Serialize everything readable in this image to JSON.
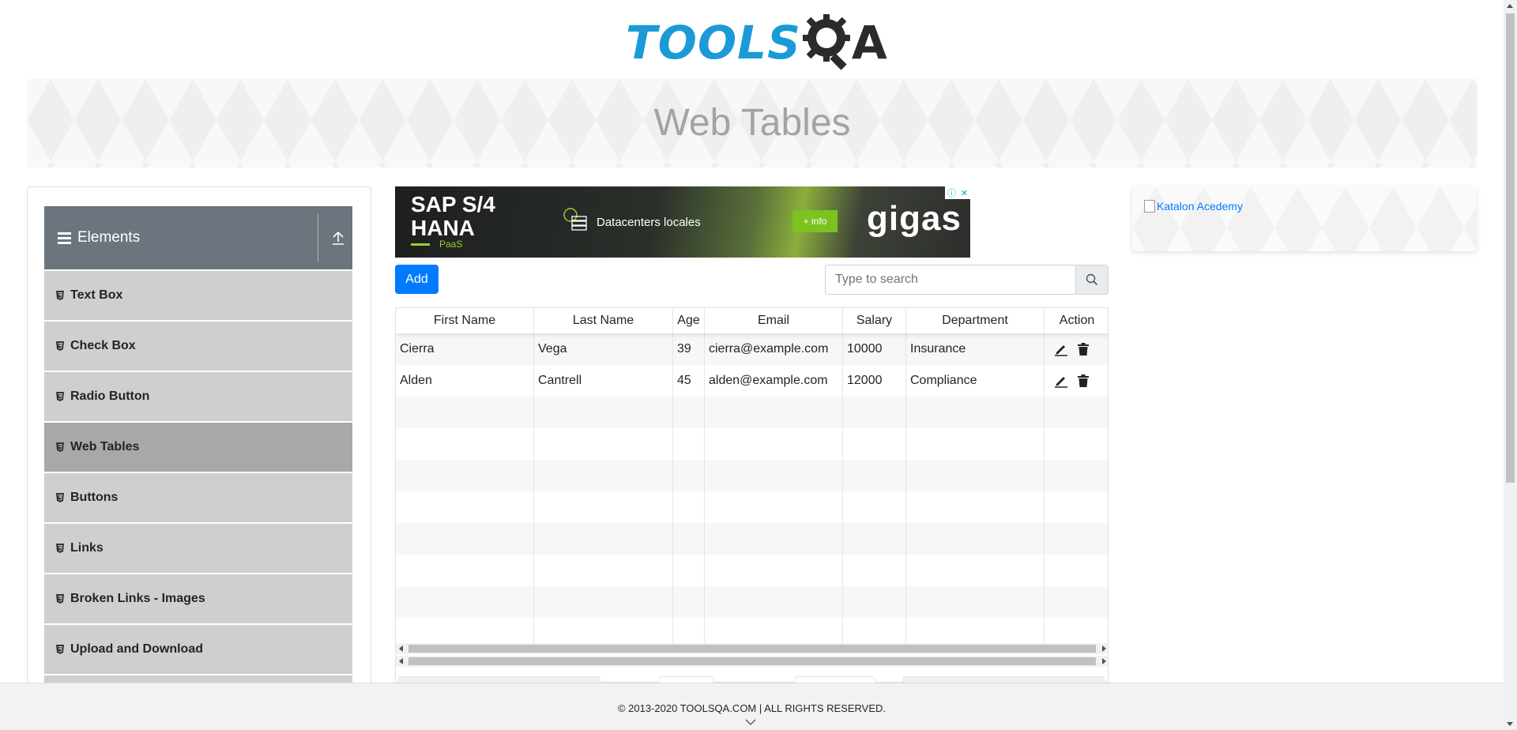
{
  "logo": {
    "part1": "TOOLS",
    "part2": "A"
  },
  "banner": {
    "title": "Web Tables"
  },
  "sidebar": {
    "group_title": "Elements",
    "items": [
      {
        "label": "Text Box"
      },
      {
        "label": "Check Box"
      },
      {
        "label": "Radio Button"
      },
      {
        "label": "Web Tables",
        "active": true
      },
      {
        "label": "Buttons"
      },
      {
        "label": "Links"
      },
      {
        "label": "Broken Links - Images"
      },
      {
        "label": "Upload and Download"
      }
    ]
  },
  "ad": {
    "headline": "SAP S/4 HANA",
    "tag": "PaaS",
    "feature": "Datacenters locales",
    "cta": "+ info",
    "brand": "gigas"
  },
  "toolbar": {
    "add_label": "Add",
    "search_placeholder": "Type to search"
  },
  "table": {
    "columns": [
      "First Name",
      "Last Name",
      "Age",
      "Email",
      "Salary",
      "Department",
      "Action"
    ],
    "rows": [
      {
        "first": "Cierra",
        "last": "Vega",
        "age": "39",
        "email": "cierra@example.com",
        "salary": "10000",
        "dept": "Insurance"
      },
      {
        "first": "Alden",
        "last": "Cantrell",
        "age": "45",
        "email": "alden@example.com",
        "salary": "12000",
        "dept": "Compliance"
      }
    ]
  },
  "right_ad": {
    "alt_text": "Katalon Acedemy"
  },
  "footer": {
    "copyright": "© 2013-2020 TOOLSQA.COM | ALL RIGHTS RESERVED."
  },
  "colors": {
    "primary": "#007bff",
    "logo_blue": "#1b9ad7",
    "sidebar_header": "#6c757d",
    "menu_item": "#cfcfcf",
    "menu_active": "#a8a8a8"
  }
}
